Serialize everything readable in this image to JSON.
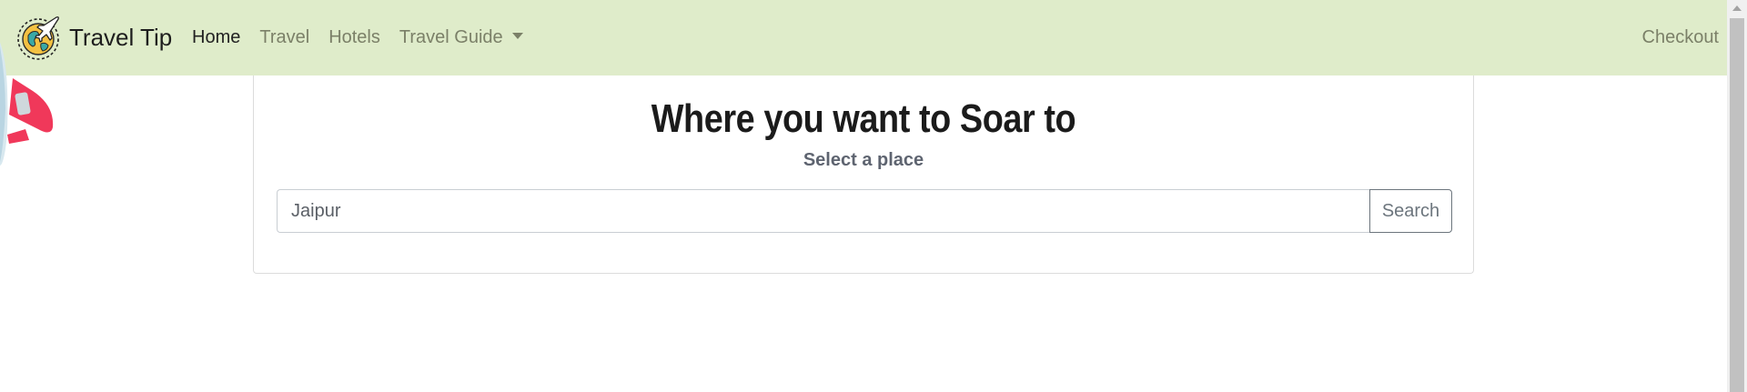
{
  "navbar": {
    "brand": "Travel Tip",
    "links": {
      "home": "Home",
      "travel": "Travel",
      "hotels": "Hotels",
      "travel_guide": "Travel Guide"
    },
    "checkout": "Checkout",
    "background": "#dfecca"
  },
  "hero": {
    "title": "Where you want to Soar to",
    "subtitle": "Select a place",
    "search": {
      "value": "Jaipur",
      "button": "Search"
    }
  }
}
